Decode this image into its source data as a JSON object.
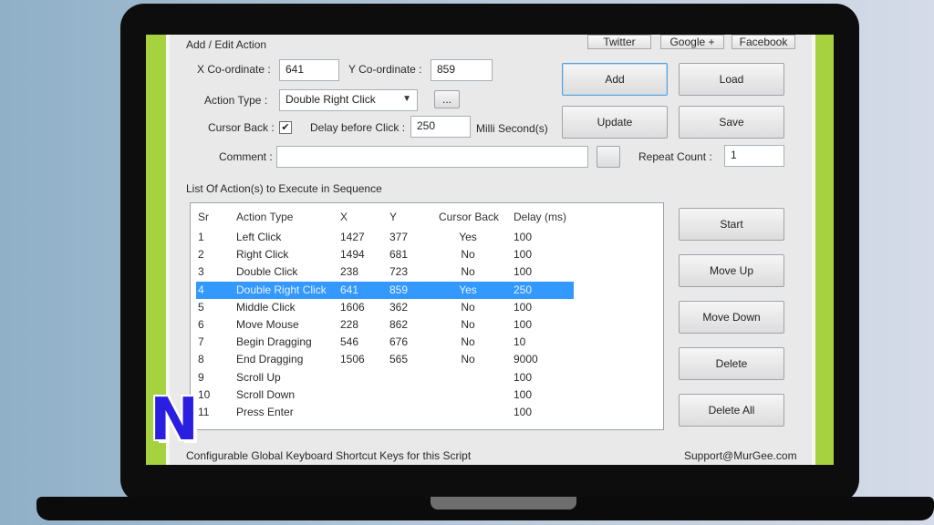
{
  "window": {
    "group_add_edit": "Add / Edit Action",
    "social": [
      "Twitter",
      "Google +",
      "Facebook"
    ],
    "x_label": "X Co-ordinate :",
    "x_value": "641",
    "y_label": "Y Co-ordinate :",
    "y_value": "859",
    "action_type_label": "Action Type :",
    "action_type_value": "Double Right Click",
    "browse_label": "...",
    "cursor_back_label": "Cursor Back :",
    "cursor_back_checked": "✔",
    "delay_label": "Delay before Click :",
    "delay_value": "250",
    "delay_unit": "Milli Second(s)",
    "comment_label": "Comment :",
    "comment_value": "",
    "repeat_label": "Repeat Count :",
    "repeat_value": "1",
    "buttons": {
      "add": "Add",
      "load": "Load",
      "update": "Update",
      "save": "Save",
      "start": "Start",
      "move_up": "Move Up",
      "move_down": "Move Down",
      "delete": "Delete",
      "delete_all": "Delete All"
    },
    "list_title": "List Of Action(s) to Execute in Sequence",
    "columns": [
      "Sr",
      "Action Type",
      "X",
      "Y",
      "Cursor Back",
      "Delay (ms)"
    ],
    "rows": [
      [
        "1",
        "Left Click",
        "1427",
        "377",
        "Yes",
        "100"
      ],
      [
        "2",
        "Right Click",
        "1494",
        "681",
        "No",
        "100"
      ],
      [
        "3",
        "Double Click",
        "238",
        "723",
        "No",
        "100"
      ],
      [
        "4",
        "Double Right Click",
        "641",
        "859",
        "Yes",
        "250"
      ],
      [
        "5",
        "Middle Click",
        "1606",
        "362",
        "No",
        "100"
      ],
      [
        "6",
        "Move Mouse",
        "228",
        "862",
        "No",
        "100"
      ],
      [
        "7",
        "Begin Dragging",
        "546",
        "676",
        "No",
        "10"
      ],
      [
        "8",
        "End Dragging",
        "1506",
        "565",
        "No",
        "9000"
      ],
      [
        "9",
        "Scroll Up",
        "",
        "",
        "",
        "100"
      ],
      [
        "10",
        "Scroll Down",
        "",
        "",
        "",
        "100"
      ],
      [
        "11",
        "Press Enter",
        "",
        "",
        "",
        "100"
      ]
    ],
    "selected_row": 3,
    "footer_left": "Configurable Global Keyboard Shortcut Keys for this Script",
    "footer_right": "Support@MurGee.com"
  },
  "overlay": {
    "logo_letter": "N"
  },
  "colors": {
    "accent_green": "#a6d23f",
    "selection": "#3399ff"
  }
}
